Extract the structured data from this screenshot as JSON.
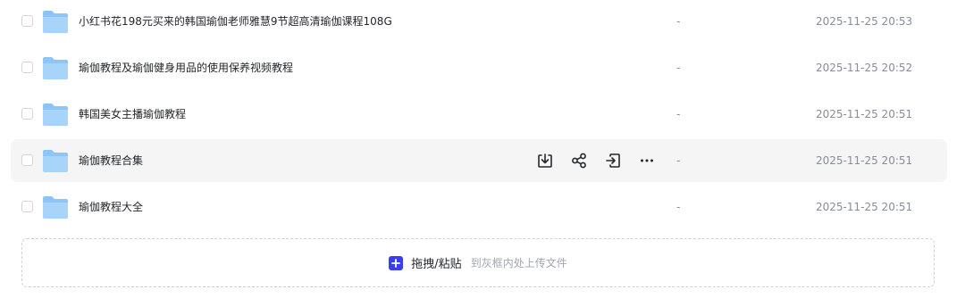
{
  "files": [
    {
      "name": "小红书花198元买来的韩国瑜伽老师雅慧9节超高清瑜伽课程108G",
      "size": "-",
      "time": "2025-11-25 20:53"
    },
    {
      "name": "瑜伽教程及瑜伽健身用品的使用保养视频教程",
      "size": "-",
      "time": "2025-11-25 20:52"
    },
    {
      "name": "韩国美女主播瑜伽教程",
      "size": "-",
      "time": "2025-11-25 20:51"
    },
    {
      "name": "瑜伽教程合集",
      "size": "-",
      "time": "2025-11-25 20:51"
    },
    {
      "name": "瑜伽教程大全",
      "size": "-",
      "time": "2025-11-25 20:51"
    }
  ],
  "row_actions": [
    "download-icon",
    "share-icon",
    "move-icon",
    "more-icon"
  ],
  "upload": {
    "label": "拖拽/粘贴",
    "hint": "到灰框内处上传文件",
    "icon": "plus-icon"
  },
  "colors": {
    "accent": "#3b3df0",
    "folder": "#8ec5f7",
    "hover_row": "#f5f5f6",
    "muted_text": "#878c9c"
  }
}
